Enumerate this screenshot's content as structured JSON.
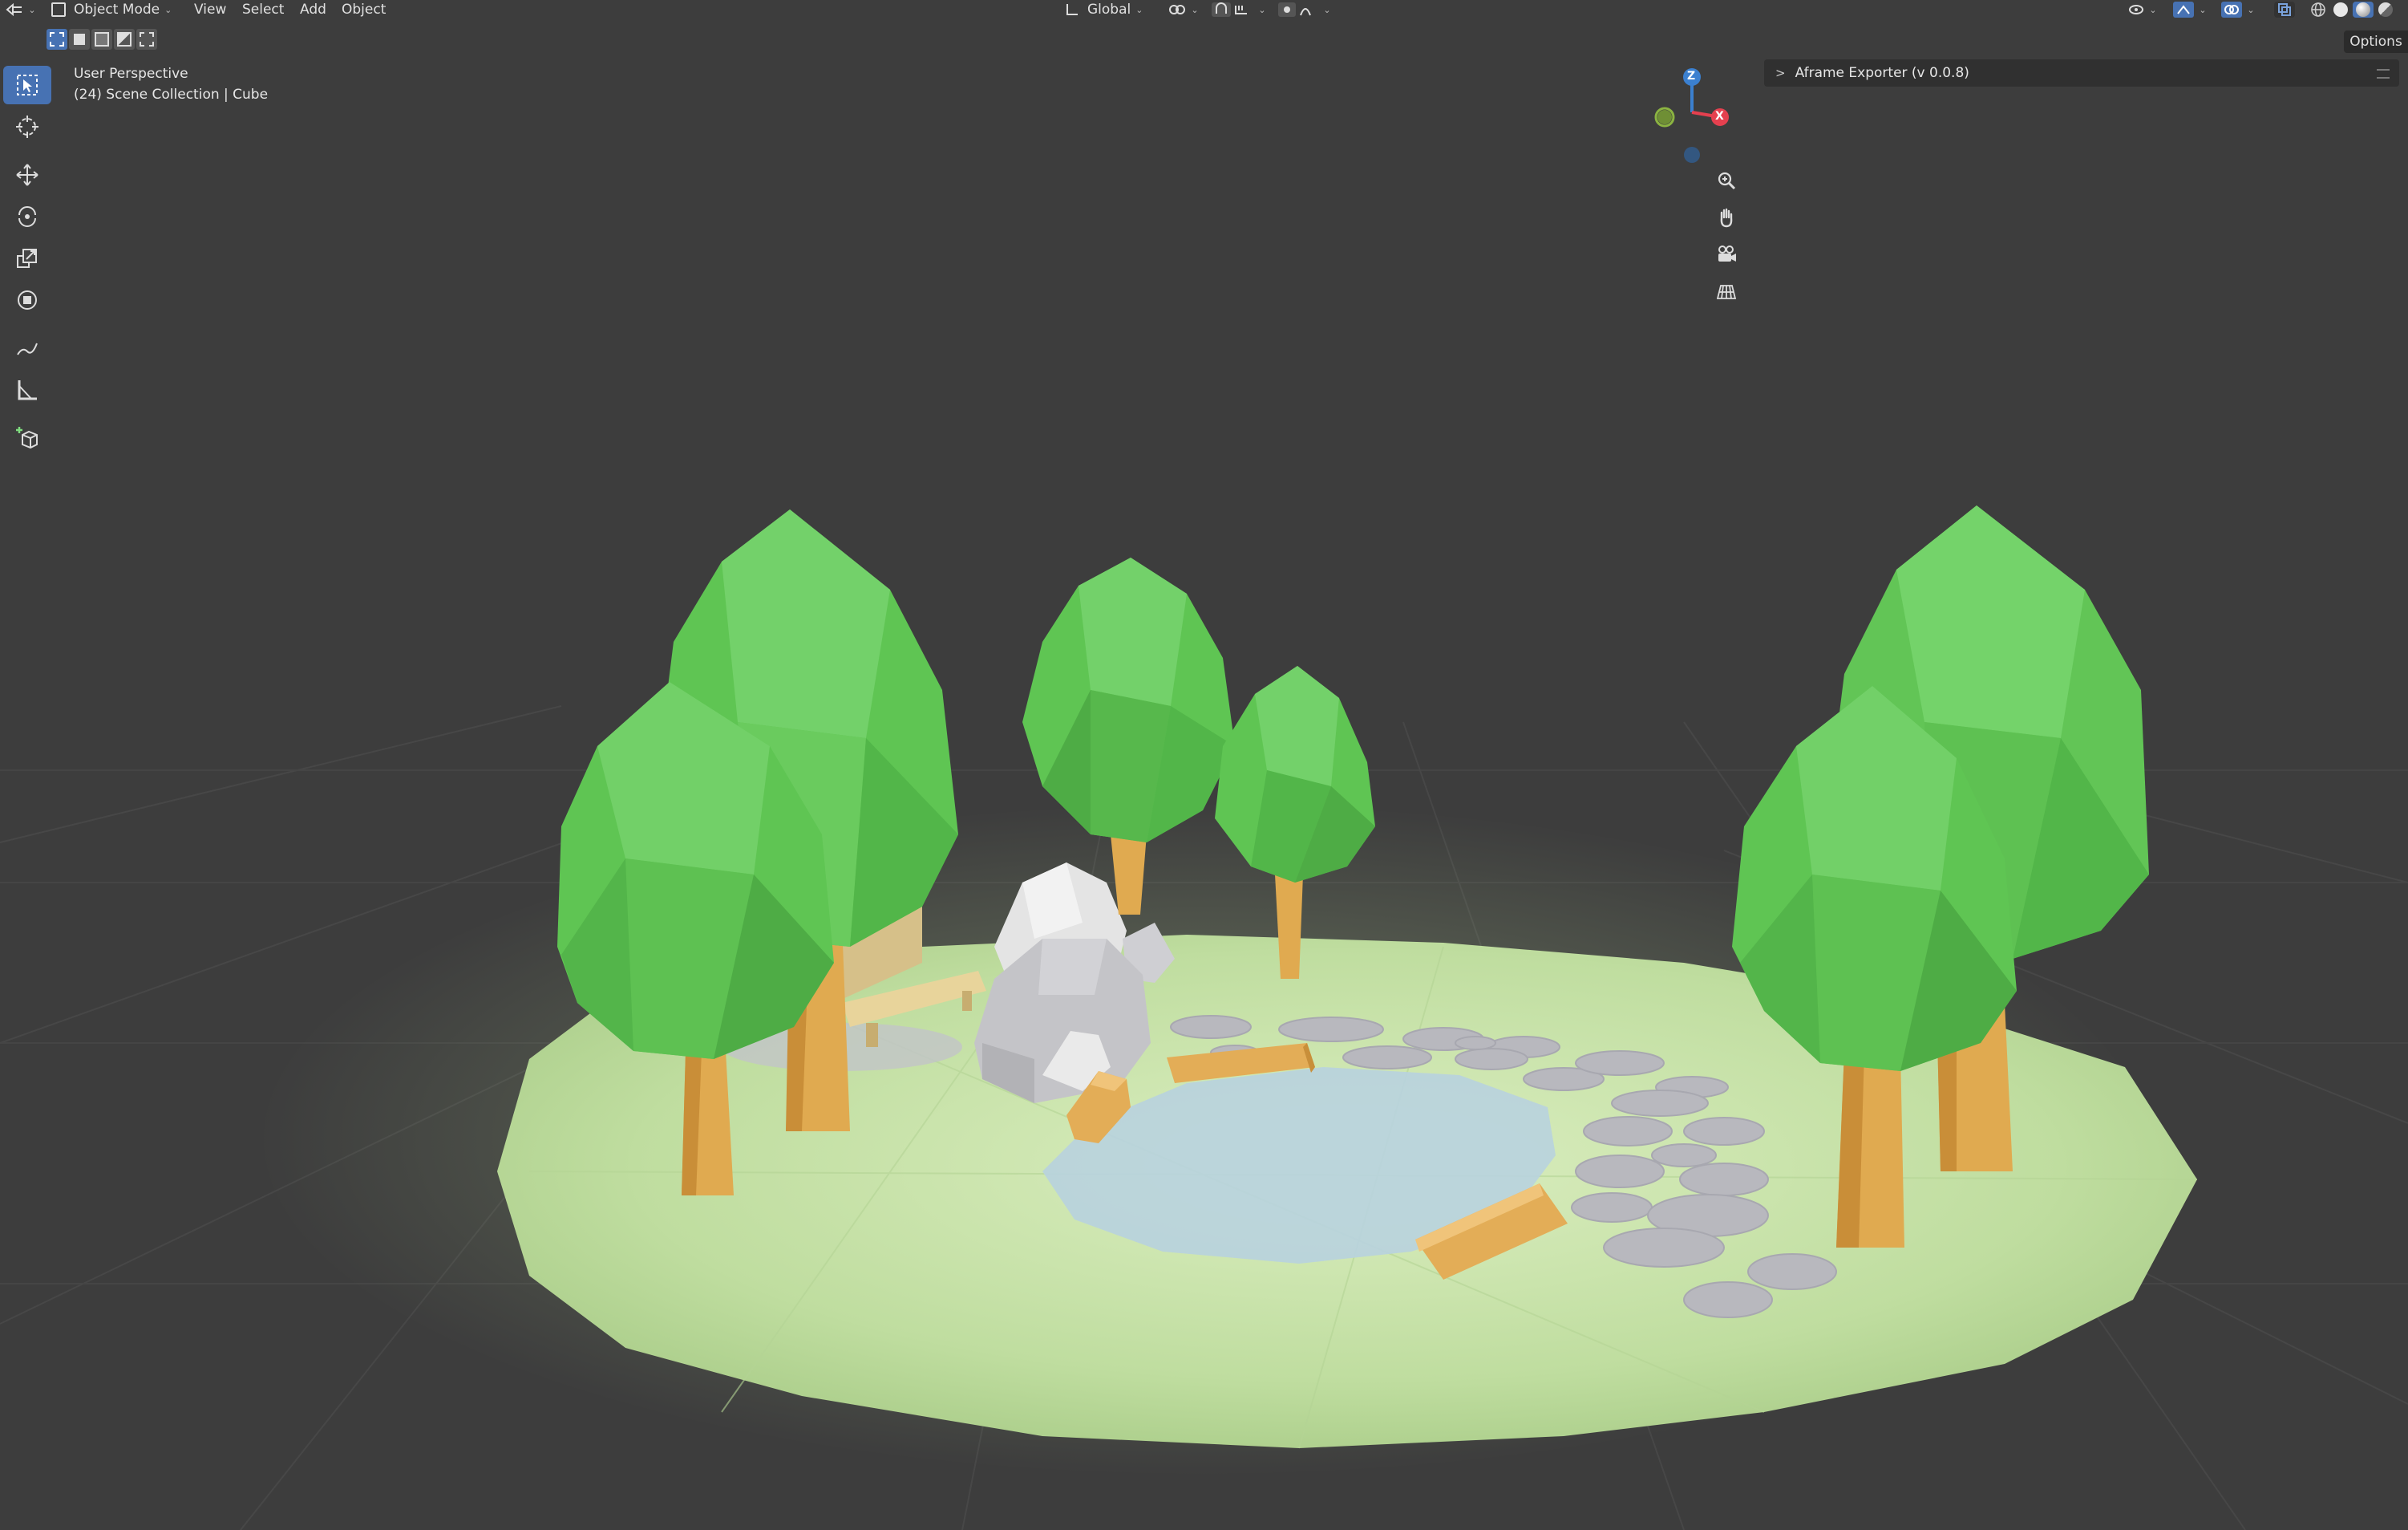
{
  "header": {
    "editor_type_icon": "editor-type-icon",
    "mode": {
      "label": "Object Mode",
      "icon": "object-mode-icon"
    },
    "menus": [
      {
        "label": "View"
      },
      {
        "label": "Select"
      },
      {
        "label": "Add"
      },
      {
        "label": "Object"
      }
    ],
    "transform_orientation": {
      "label": "Global",
      "icon": "orientation-icon"
    },
    "pivot_icon": "pivot-icon",
    "snap_icon": "snap-icon",
    "proportional_icon": "proportional-icon",
    "right_icons": [
      "visibility-icon",
      "gizmo-icon",
      "overlay-icon",
      "xray-icon",
      "wireframe-shading-icon",
      "solid-shading-icon",
      "material-shading-icon",
      "rendered-shading-icon"
    ]
  },
  "select_modes": [
    "select-new-icon",
    "select-extend-icon",
    "select-subtract-icon",
    "select-invert-icon",
    "select-intersect-icon"
  ],
  "toolbar": {
    "tools": [
      "select-box-icon",
      "cursor-icon",
      "move-icon",
      "rotate-icon",
      "scale-icon",
      "transform-icon",
      "annotate-icon",
      "measure-icon",
      "add-cube-icon"
    ]
  },
  "viewport": {
    "view_name": "User Perspective",
    "collection_info": "(24) Scene Collection | Cube"
  },
  "gizmo": {
    "z_label": "Z",
    "x_label": "X",
    "colors": {
      "x": "#e5404f",
      "y": "#8bb341",
      "z": "#3b80d0"
    }
  },
  "navigation": [
    "zoom-icon",
    "hand-pan-icon",
    "camera-icon",
    "grid-ortho-icon"
  ],
  "sidebar": {
    "options_label": "Options",
    "panel_title": "Aframe Exporter (v 0.0.8)"
  },
  "colors": {
    "background": "#3d3d3d",
    "accent": "#4772b3",
    "foliage": "#62c95a",
    "ground": "#c5e1a5",
    "water": "#b9d4e0",
    "trunk": "#e0aa50",
    "stone": "#b8b8be"
  }
}
